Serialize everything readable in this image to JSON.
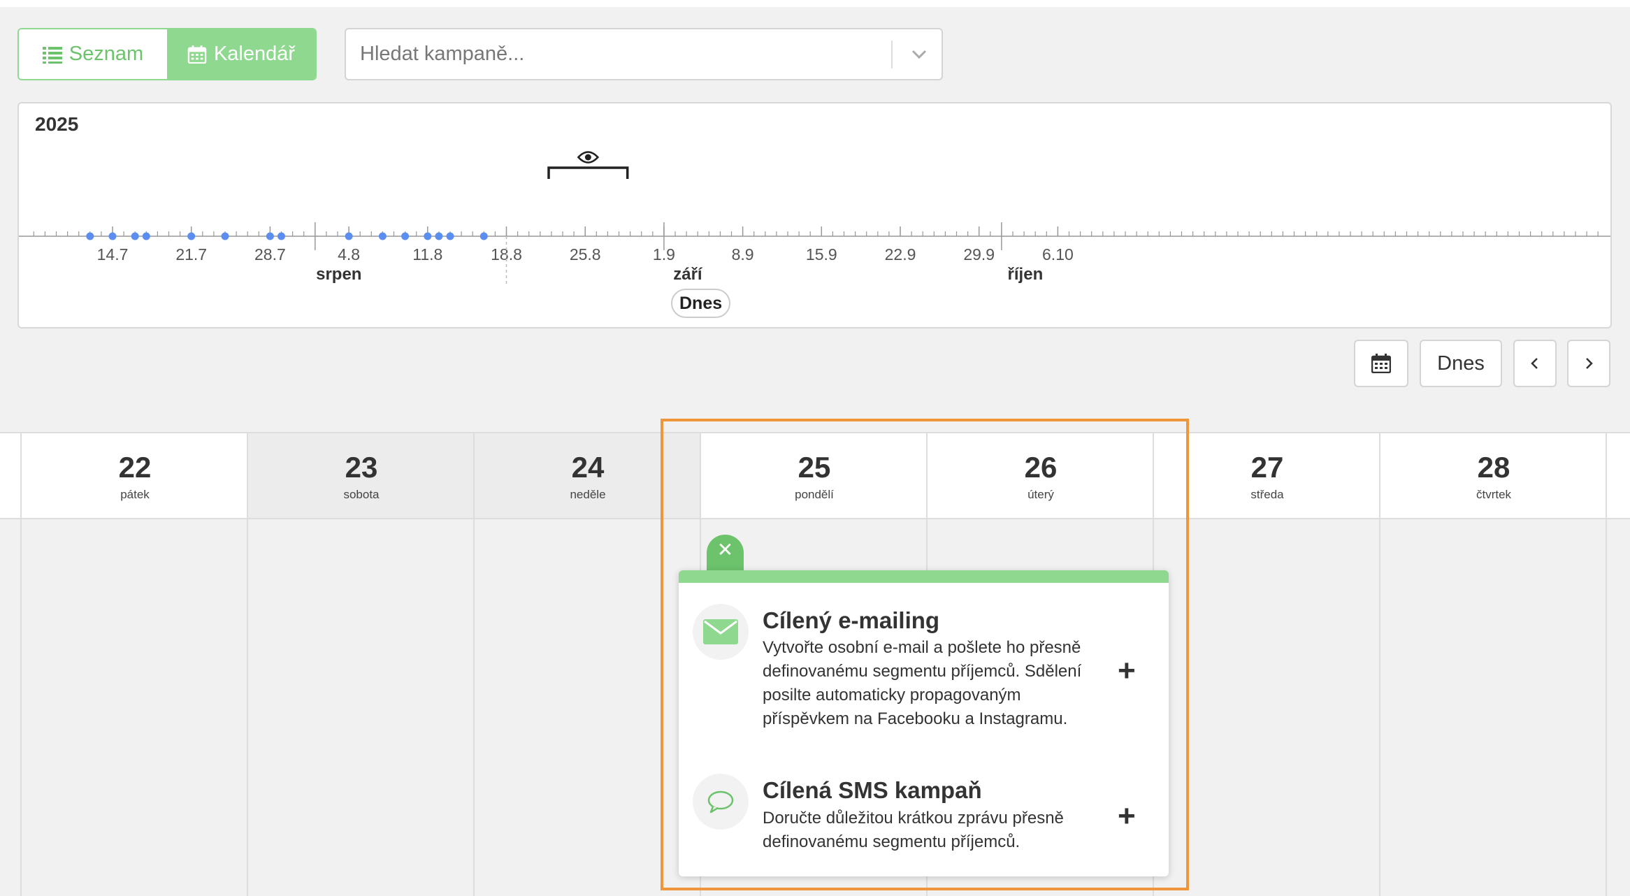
{
  "view_toggle": {
    "list_label": "Seznam",
    "calendar_label": "Kalendář",
    "active": "calendar"
  },
  "search": {
    "placeholder": "Hledat kampaně..."
  },
  "timeline": {
    "year": "2025",
    "date_ticks": [
      "14.7",
      "21.7",
      "28.7",
      "4.8",
      "11.8",
      "18.8",
      "25.8",
      "1.9",
      "8.9",
      "15.9",
      "22.9",
      "29.9",
      "6.10"
    ],
    "months": [
      "srpen",
      "září",
      "říjen"
    ],
    "today_label": "Dnes",
    "accent_color": "#5b8ef0"
  },
  "nav": {
    "calendar_icon": "calendar-icon",
    "today_label": "Dnes",
    "prev_icon": "chevron-left-icon",
    "next_icon": "chevron-right-icon"
  },
  "calendar": {
    "days": [
      {
        "num": "22",
        "name": "pátek"
      },
      {
        "num": "23",
        "name": "sobota"
      },
      {
        "num": "24",
        "name": "neděle"
      },
      {
        "num": "25",
        "name": "pondělí"
      },
      {
        "num": "26",
        "name": "úterý"
      },
      {
        "num": "27",
        "name": "středa"
      },
      {
        "num": "28",
        "name": "čtvrtek"
      }
    ]
  },
  "popup": {
    "close_icon": "close-icon",
    "items": [
      {
        "title": "Cílený e-mailing",
        "desc": "Vytvořte osobní e-mail a pošlete ho přesně definovanému segmentu příjemců. Sdělení posilte automaticky propagovaným příspěvkem na Facebooku a Instagramu.",
        "icon": "envelope-icon"
      },
      {
        "title": "Cílená SMS kampaň",
        "desc": "Doručte důležitou krátkou zprávu přesně definovanému segmentu příjemců.",
        "icon": "chat-bubble-icon"
      }
    ]
  },
  "colors": {
    "green": "#8fd88f",
    "green_dark": "#6cc36c",
    "highlight": "#f0963a"
  }
}
